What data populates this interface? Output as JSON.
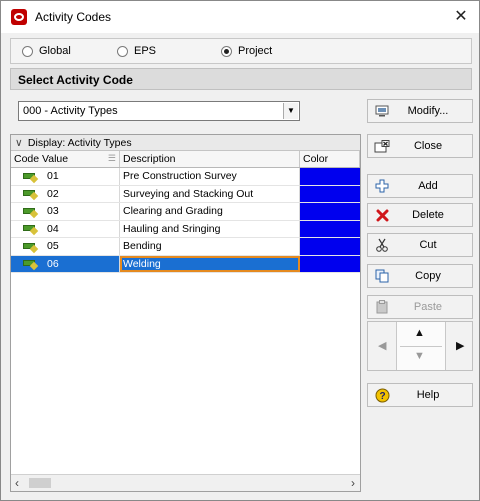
{
  "window": {
    "title": "Activity Codes"
  },
  "scope": {
    "options": [
      {
        "label": "Global",
        "selected": false
      },
      {
        "label": "EPS",
        "selected": false
      },
      {
        "label": "Project",
        "selected": true
      }
    ]
  },
  "select_section": {
    "heading": "Select Activity Code",
    "dropdown_value": "000 - Activity Types",
    "modify_label": "Modify..."
  },
  "grid": {
    "display_label": "Display: Activity Types",
    "columns": [
      "Code Value",
      "Description",
      "Color"
    ],
    "rows": [
      {
        "code": "01",
        "description": "Pre Construction Survey",
        "color": "#0000ee",
        "selected": false
      },
      {
        "code": "02",
        "description": "Surveying and Stacking Out",
        "color": "#0000ee",
        "selected": false
      },
      {
        "code": "03",
        "description": "Clearing and Grading",
        "color": "#0000ee",
        "selected": false
      },
      {
        "code": "04",
        "description": "Hauling and Sringing",
        "color": "#0000ee",
        "selected": false
      },
      {
        "code": "05",
        "description": "Bending",
        "color": "#0000ee",
        "selected": false
      },
      {
        "code": "06",
        "description": "Welding",
        "color": "#0000ee",
        "selected": true
      }
    ]
  },
  "buttons": {
    "close": "Close",
    "add": "Add",
    "delete": "Delete",
    "cut": "Cut",
    "copy": "Copy",
    "paste": "Paste",
    "help": "Help"
  },
  "colors": {
    "selection": "#1a6fd2",
    "code_color": "#0000ee",
    "focus_outline": "#e58a1f"
  }
}
